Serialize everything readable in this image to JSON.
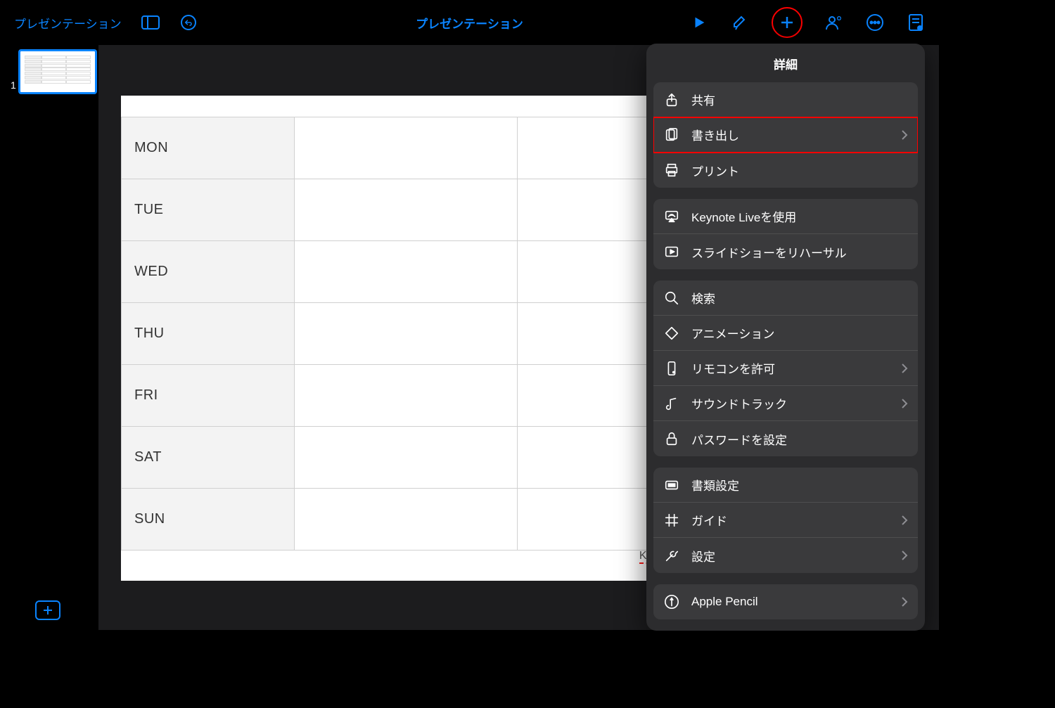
{
  "toolbar": {
    "back_label": "プレゼンテーション",
    "title": "プレゼンテーション"
  },
  "sidebar": {
    "slide_number": "1"
  },
  "slide": {
    "days": [
      "MON",
      "TUE",
      "WED",
      "THU",
      "FRI",
      "SAT",
      "SUN"
    ],
    "brand": "KERENOR"
  },
  "popover": {
    "title": "詳細",
    "groups": [
      {
        "items": [
          {
            "id": "share",
            "label": "共有",
            "icon": "share",
            "chevron": false,
            "highlighted": false
          },
          {
            "id": "export",
            "label": "書き出し",
            "icon": "export",
            "chevron": true,
            "highlighted": true
          },
          {
            "id": "print",
            "label": "プリント",
            "icon": "print",
            "chevron": false,
            "highlighted": false
          }
        ]
      },
      {
        "items": [
          {
            "id": "keynote-live",
            "label": "Keynote Liveを使用",
            "icon": "airplay",
            "chevron": false,
            "highlighted": false
          },
          {
            "id": "rehearse",
            "label": "スライドショーをリハーサル",
            "icon": "playbox",
            "chevron": false,
            "highlighted": false
          }
        ]
      },
      {
        "items": [
          {
            "id": "search",
            "label": "検索",
            "icon": "search",
            "chevron": false,
            "highlighted": false
          },
          {
            "id": "animation",
            "label": "アニメーション",
            "icon": "diamond",
            "chevron": false,
            "highlighted": false
          },
          {
            "id": "remote",
            "label": "リモコンを許可",
            "icon": "phone",
            "chevron": true,
            "highlighted": false
          },
          {
            "id": "soundtrack",
            "label": "サウンドトラック",
            "icon": "note",
            "chevron": true,
            "highlighted": false
          },
          {
            "id": "password",
            "label": "パスワードを設定",
            "icon": "lock",
            "chevron": false,
            "highlighted": false
          }
        ]
      },
      {
        "items": [
          {
            "id": "doc-settings",
            "label": "書類設定",
            "icon": "doc",
            "chevron": false,
            "highlighted": false
          },
          {
            "id": "guides",
            "label": "ガイド",
            "icon": "grid",
            "chevron": true,
            "highlighted": false
          },
          {
            "id": "settings",
            "label": "設定",
            "icon": "wrench",
            "chevron": true,
            "highlighted": false
          }
        ]
      },
      {
        "items": [
          {
            "id": "apple-pencil",
            "label": "Apple Pencil",
            "icon": "pencil",
            "chevron": true,
            "highlighted": false
          }
        ]
      }
    ]
  }
}
